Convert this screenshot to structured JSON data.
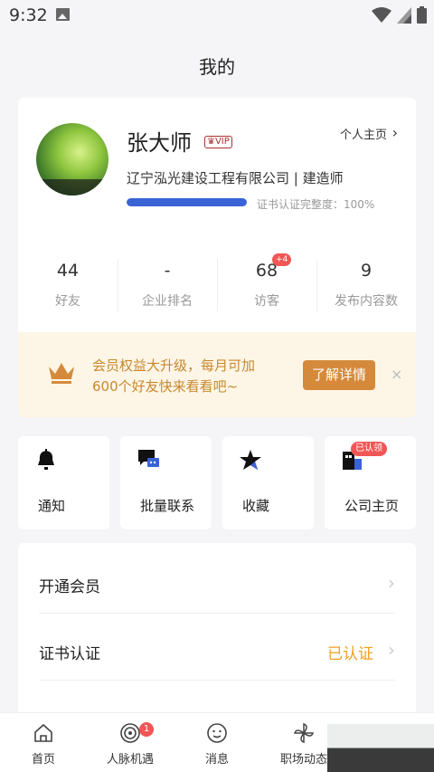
{
  "status_bar": {
    "time": "9:32"
  },
  "header": {
    "title": "我的"
  },
  "profile": {
    "name": "张大师",
    "vip_label": "VIP",
    "home_link": "个人主页",
    "company_line": "辽宁泓光建设工程有限公司 | 建造师",
    "progress_label": "证书认证完整度：100%",
    "progress_fraction": 1.0
  },
  "stats": [
    {
      "value": "44",
      "label": "好友"
    },
    {
      "value": "-",
      "label": "企业排名"
    },
    {
      "value": "68",
      "label": "访客",
      "badge": "+4"
    },
    {
      "value": "9",
      "label": "发布内容数"
    }
  ],
  "promo": {
    "line1": "会员权益大升级，每月可加",
    "line2": "600个好友快来看看吧~",
    "button": "了解详情",
    "close": "×"
  },
  "shortcuts": [
    {
      "label": "通知",
      "icon": "bell-icon"
    },
    {
      "label": "批量联系",
      "icon": "chat-icon"
    },
    {
      "label": "收藏",
      "icon": "star-icon"
    },
    {
      "label": "公司主页",
      "icon": "building-icon",
      "badge": "已认领"
    }
  ],
  "menu": [
    {
      "label": "开通会员",
      "value": ""
    },
    {
      "label": "证书认证",
      "value": "已认证"
    }
  ],
  "tabbar": [
    {
      "label": "首页",
      "icon": "home-icon"
    },
    {
      "label": "人脉机遇",
      "icon": "network-icon",
      "badge": "1"
    },
    {
      "label": "消息",
      "icon": "message-icon"
    },
    {
      "label": "职场动态",
      "icon": "pinwheel-icon"
    }
  ],
  "colors": {
    "accent_blue": "#3a63d6",
    "promo_orange": "#d58a3b",
    "badge_red": "#f25555",
    "certified_orange": "#f0a020"
  }
}
